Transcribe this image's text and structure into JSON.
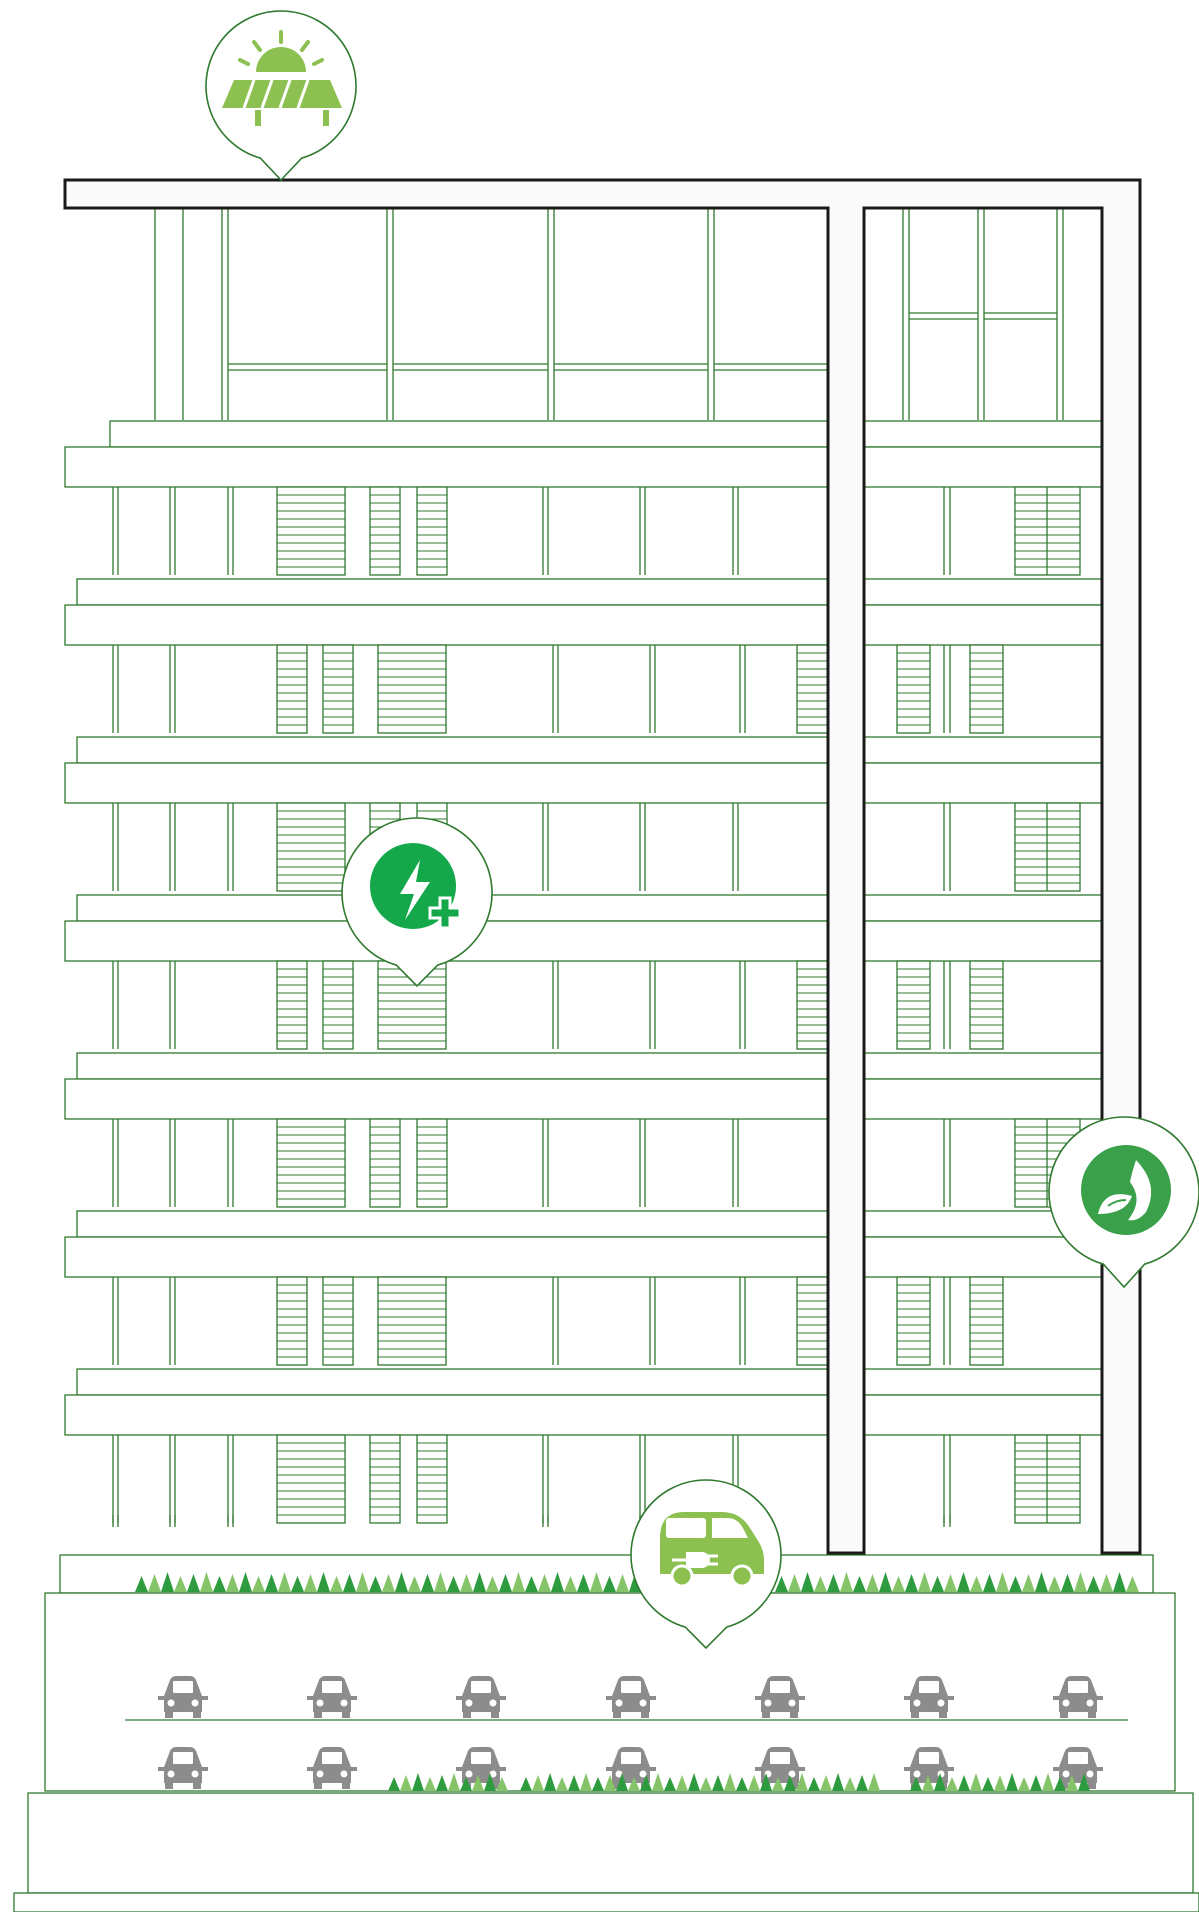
{
  "colors": {
    "line": "#2f7a2f",
    "frame": "#1a1a1a",
    "fill": "#fafafa",
    "car": "#8c8c8c",
    "leaf_dark": "#2e9c3e",
    "leaf_light": "#86c46a",
    "icon_light": "#8cc152",
    "icon_dark": "#14a84a",
    "icon_mid": "#3aa14a"
  },
  "callouts": [
    {
      "icon": "solar-panel-icon"
    },
    {
      "icon": "energy-plus-icon"
    },
    {
      "icon": "leaf-flame-icon"
    },
    {
      "icon": "electric-car-icon"
    }
  ],
  "parking": {
    "rows": 2,
    "cars_per_row": 7
  },
  "floors": {
    "count": 7
  }
}
